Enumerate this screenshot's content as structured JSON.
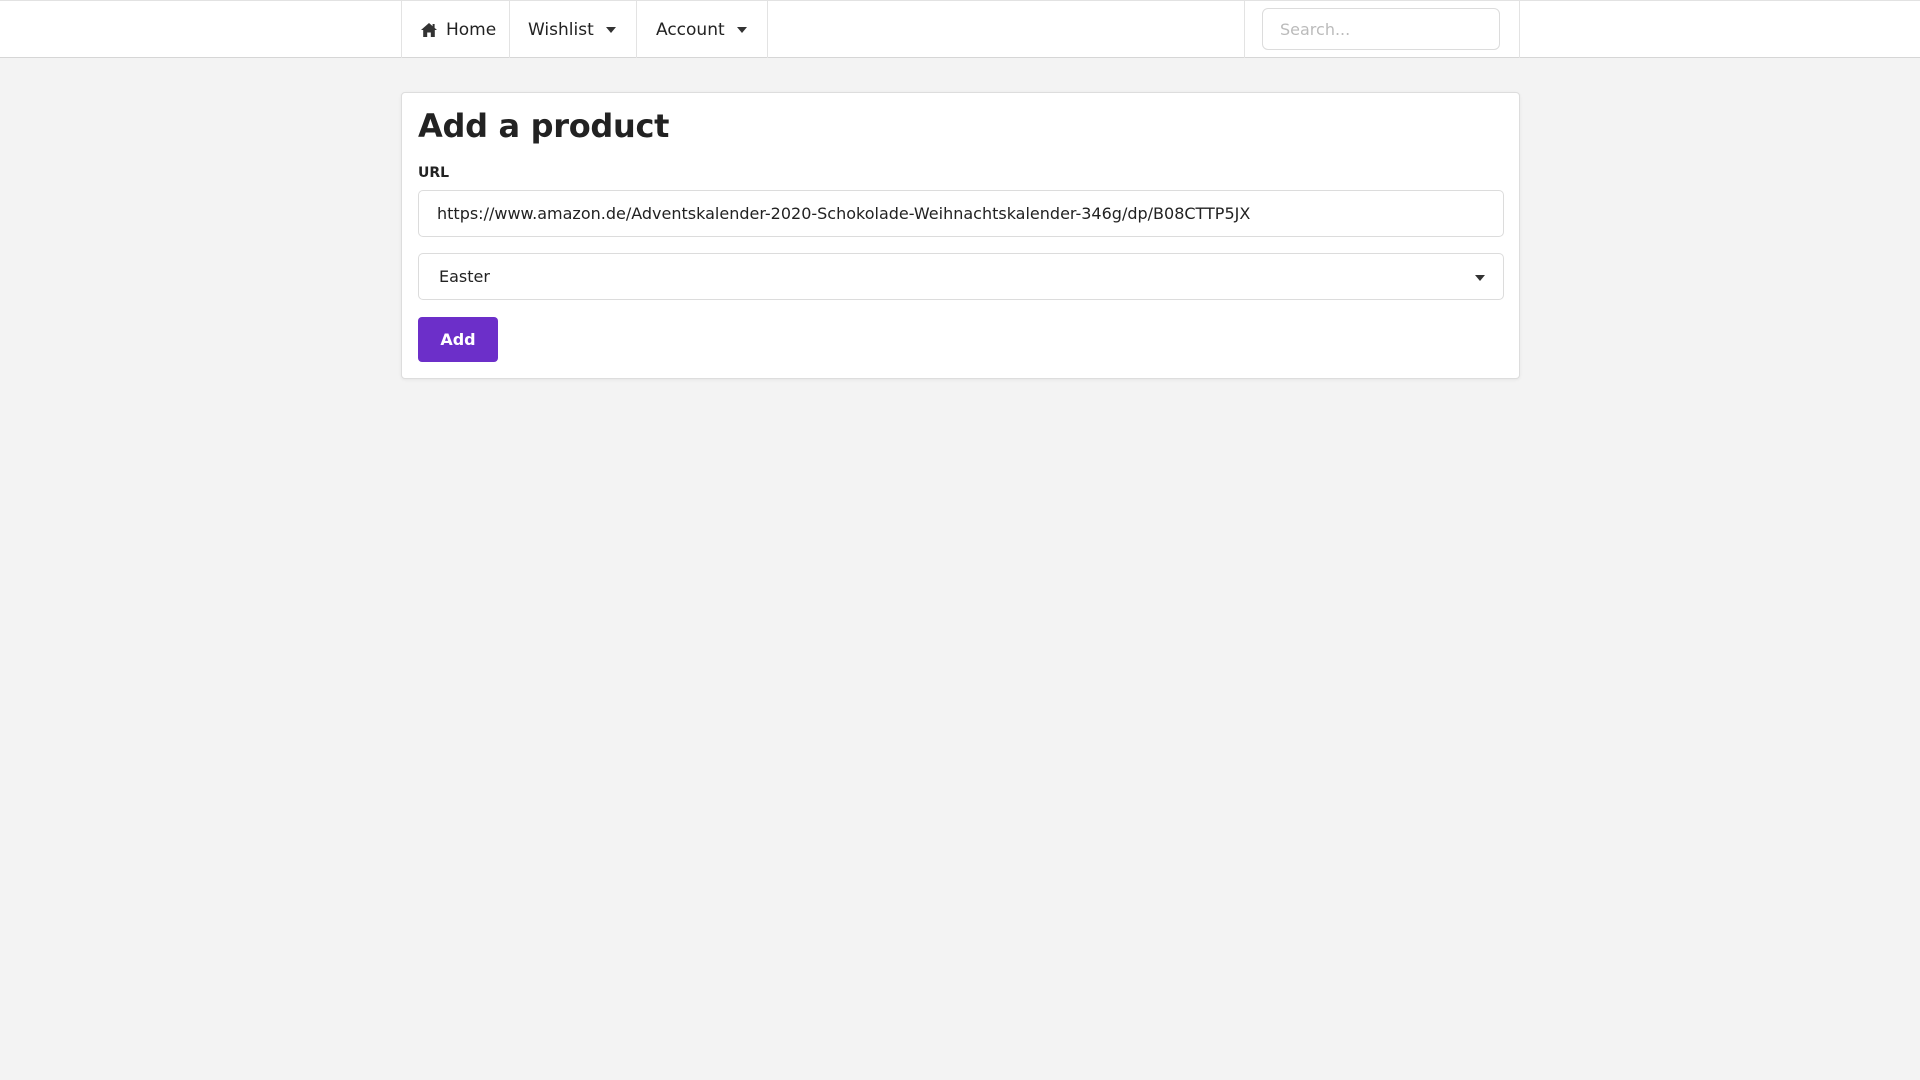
{
  "nav": {
    "home_label": "Home",
    "home_icon": "home-icon",
    "wishlist_label": "Wishlist",
    "account_label": "Account",
    "search_placeholder": "Search..."
  },
  "form": {
    "title": "Add a product",
    "url_label": "URL",
    "url_value": "https://www.amazon.de/Adventskalender-2020-Schokolade-Weihnachtskalender-346g/dp/B08CTTP5JX",
    "selected_wishlist": "Easter",
    "add_button_label": "Add"
  },
  "colors": {
    "accent": "#6c2fc9",
    "background": "#f3f3f3",
    "card": "#ffffff"
  }
}
